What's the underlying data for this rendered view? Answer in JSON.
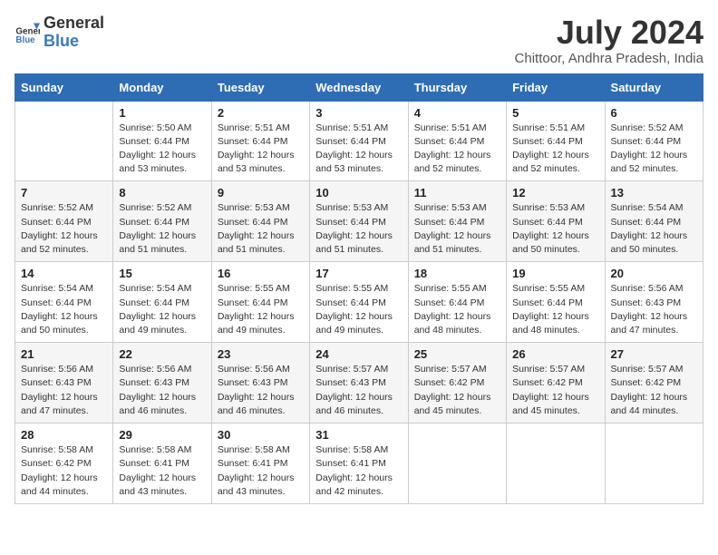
{
  "header": {
    "logo_general": "General",
    "logo_blue": "Blue",
    "month_year": "July 2024",
    "location": "Chittoor, Andhra Pradesh, India"
  },
  "days_of_week": [
    "Sunday",
    "Monday",
    "Tuesday",
    "Wednesday",
    "Thursday",
    "Friday",
    "Saturday"
  ],
  "weeks": [
    [
      {
        "day": "",
        "info": ""
      },
      {
        "day": "1",
        "info": "Sunrise: 5:50 AM\nSunset: 6:44 PM\nDaylight: 12 hours\nand 53 minutes."
      },
      {
        "day": "2",
        "info": "Sunrise: 5:51 AM\nSunset: 6:44 PM\nDaylight: 12 hours\nand 53 minutes."
      },
      {
        "day": "3",
        "info": "Sunrise: 5:51 AM\nSunset: 6:44 PM\nDaylight: 12 hours\nand 53 minutes."
      },
      {
        "day": "4",
        "info": "Sunrise: 5:51 AM\nSunset: 6:44 PM\nDaylight: 12 hours\nand 52 minutes."
      },
      {
        "day": "5",
        "info": "Sunrise: 5:51 AM\nSunset: 6:44 PM\nDaylight: 12 hours\nand 52 minutes."
      },
      {
        "day": "6",
        "info": "Sunrise: 5:52 AM\nSunset: 6:44 PM\nDaylight: 12 hours\nand 52 minutes."
      }
    ],
    [
      {
        "day": "7",
        "info": "Sunrise: 5:52 AM\nSunset: 6:44 PM\nDaylight: 12 hours\nand 52 minutes."
      },
      {
        "day": "8",
        "info": "Sunrise: 5:52 AM\nSunset: 6:44 PM\nDaylight: 12 hours\nand 51 minutes."
      },
      {
        "day": "9",
        "info": "Sunrise: 5:53 AM\nSunset: 6:44 PM\nDaylight: 12 hours\nand 51 minutes."
      },
      {
        "day": "10",
        "info": "Sunrise: 5:53 AM\nSunset: 6:44 PM\nDaylight: 12 hours\nand 51 minutes."
      },
      {
        "day": "11",
        "info": "Sunrise: 5:53 AM\nSunset: 6:44 PM\nDaylight: 12 hours\nand 51 minutes."
      },
      {
        "day": "12",
        "info": "Sunrise: 5:53 AM\nSunset: 6:44 PM\nDaylight: 12 hours\nand 50 minutes."
      },
      {
        "day": "13",
        "info": "Sunrise: 5:54 AM\nSunset: 6:44 PM\nDaylight: 12 hours\nand 50 minutes."
      }
    ],
    [
      {
        "day": "14",
        "info": "Sunrise: 5:54 AM\nSunset: 6:44 PM\nDaylight: 12 hours\nand 50 minutes."
      },
      {
        "day": "15",
        "info": "Sunrise: 5:54 AM\nSunset: 6:44 PM\nDaylight: 12 hours\nand 49 minutes."
      },
      {
        "day": "16",
        "info": "Sunrise: 5:55 AM\nSunset: 6:44 PM\nDaylight: 12 hours\nand 49 minutes."
      },
      {
        "day": "17",
        "info": "Sunrise: 5:55 AM\nSunset: 6:44 PM\nDaylight: 12 hours\nand 49 minutes."
      },
      {
        "day": "18",
        "info": "Sunrise: 5:55 AM\nSunset: 6:44 PM\nDaylight: 12 hours\nand 48 minutes."
      },
      {
        "day": "19",
        "info": "Sunrise: 5:55 AM\nSunset: 6:44 PM\nDaylight: 12 hours\nand 48 minutes."
      },
      {
        "day": "20",
        "info": "Sunrise: 5:56 AM\nSunset: 6:43 PM\nDaylight: 12 hours\nand 47 minutes."
      }
    ],
    [
      {
        "day": "21",
        "info": "Sunrise: 5:56 AM\nSunset: 6:43 PM\nDaylight: 12 hours\nand 47 minutes."
      },
      {
        "day": "22",
        "info": "Sunrise: 5:56 AM\nSunset: 6:43 PM\nDaylight: 12 hours\nand 46 minutes."
      },
      {
        "day": "23",
        "info": "Sunrise: 5:56 AM\nSunset: 6:43 PM\nDaylight: 12 hours\nand 46 minutes."
      },
      {
        "day": "24",
        "info": "Sunrise: 5:57 AM\nSunset: 6:43 PM\nDaylight: 12 hours\nand 46 minutes."
      },
      {
        "day": "25",
        "info": "Sunrise: 5:57 AM\nSunset: 6:42 PM\nDaylight: 12 hours\nand 45 minutes."
      },
      {
        "day": "26",
        "info": "Sunrise: 5:57 AM\nSunset: 6:42 PM\nDaylight: 12 hours\nand 45 minutes."
      },
      {
        "day": "27",
        "info": "Sunrise: 5:57 AM\nSunset: 6:42 PM\nDaylight: 12 hours\nand 44 minutes."
      }
    ],
    [
      {
        "day": "28",
        "info": "Sunrise: 5:58 AM\nSunset: 6:42 PM\nDaylight: 12 hours\nand 44 minutes."
      },
      {
        "day": "29",
        "info": "Sunrise: 5:58 AM\nSunset: 6:41 PM\nDaylight: 12 hours\nand 43 minutes."
      },
      {
        "day": "30",
        "info": "Sunrise: 5:58 AM\nSunset: 6:41 PM\nDaylight: 12 hours\nand 43 minutes."
      },
      {
        "day": "31",
        "info": "Sunrise: 5:58 AM\nSunset: 6:41 PM\nDaylight: 12 hours\nand 42 minutes."
      },
      {
        "day": "",
        "info": ""
      },
      {
        "day": "",
        "info": ""
      },
      {
        "day": "",
        "info": ""
      }
    ]
  ]
}
